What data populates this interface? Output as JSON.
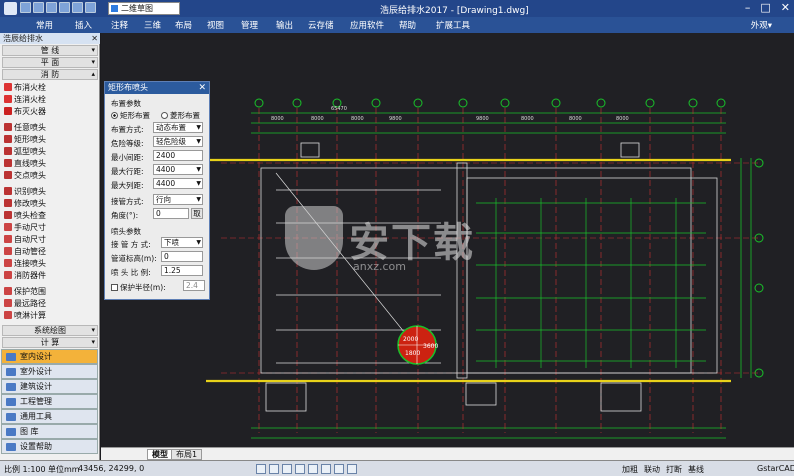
{
  "app": {
    "window_title": "浩辰给排水2017 - [Drawing1.dwg]",
    "view_combo": "二维草图",
    "outer_label": "外观▾"
  },
  "menu": [
    "常用",
    "插入",
    "注释",
    "三维",
    "布局",
    "视图",
    "管理",
    "输出",
    "云存储",
    "应用软件",
    "帮助",
    "扩展工具"
  ],
  "left_panel": {
    "title": "浩辰给排水",
    "groups": [
      "管 线",
      "平 面",
      "消 防"
    ],
    "commands": [
      {
        "label": "布消火栓",
        "icon": "hydrant-icon"
      },
      {
        "label": "连消火栓",
        "icon": "hydrant-link-icon"
      },
      {
        "label": "布灭火器",
        "icon": "extinguisher-icon"
      },
      {
        "label": "任意喷头",
        "icon": "sprinkler-icon"
      },
      {
        "label": "矩形喷头",
        "icon": "sprinkler-rect-icon"
      },
      {
        "label": "弧型喷头",
        "icon": "sprinkler-arc-icon"
      },
      {
        "label": "直线喷头",
        "icon": "sprinkler-line-icon"
      },
      {
        "label": "交点喷头",
        "icon": "sprinkler-cross-icon"
      },
      {
        "label": "识别喷头",
        "icon": "sprinkler-detect-icon"
      },
      {
        "label": "修改喷头",
        "icon": "sprinkler-edit-icon"
      },
      {
        "label": "喷头检查",
        "icon": "sprinkler-check-icon"
      },
      {
        "label": "手动尺寸",
        "icon": "dim-manual-icon"
      },
      {
        "label": "自动尺寸",
        "icon": "dim-auto-icon"
      },
      {
        "label": "自动管径",
        "icon": "pipe-diameter-icon"
      },
      {
        "label": "连接喷头",
        "icon": "sprinkler-connect-icon"
      },
      {
        "label": "消防器件",
        "icon": "fire-device-icon"
      },
      {
        "label": "保护范围",
        "icon": "protect-range-icon"
      },
      {
        "label": "最远路径",
        "icon": "far-path-icon"
      },
      {
        "label": "喷淋计算",
        "icon": "spray-calc-icon"
      }
    ],
    "sub_groups": [
      "系统绘图",
      "计 算"
    ],
    "categories": [
      {
        "label": "室内设计",
        "active": true
      },
      {
        "label": "室外设计",
        "active": false
      },
      {
        "label": "建筑设计",
        "active": false
      },
      {
        "label": "工程管理",
        "active": false
      },
      {
        "label": "通用工具",
        "active": false
      },
      {
        "label": "图 库",
        "active": false
      },
      {
        "label": "设置帮助",
        "active": false
      }
    ]
  },
  "dialog": {
    "title": "矩形布喷头",
    "section1": "布置参数",
    "radio_rect": "矩形布置",
    "radio_diamond": "菱形布置",
    "mode_label": "布置方式:",
    "mode_value": "动态布置",
    "hazard_label": "危险等级:",
    "hazard_value": "轻危险级",
    "min_spacing_label": "最小间距:",
    "min_spacing_value": "2400",
    "max_row_label": "最大行距:",
    "max_row_value": "4400",
    "max_col_label": "最大列距:",
    "max_col_value": "4400",
    "connect_label": "接管方式:",
    "connect_value": "行向",
    "angle_label": "角度(°):",
    "angle_value": "0",
    "angle_btn": "取",
    "section2": "喷头参数",
    "pipe_mode_label": "接 管 方 式:",
    "pipe_mode_value": "下喷",
    "pipe_elev_label": "管道标高(m):",
    "pipe_elev_value": "0",
    "ratio_label": "喷 头 比 例:",
    "ratio_value": "1.25",
    "protect_label": "保护半径(m):",
    "protect_value": "2.4"
  },
  "drawing": {
    "dims": [
      "8000",
      "8000",
      "8000",
      "9800",
      "9800",
      "8000",
      "8000",
      "8000"
    ],
    "total_dim": "65470",
    "circle_labels": [
      "2000",
      "1800",
      "3600"
    ]
  },
  "tabs": [
    "模型",
    "布局1"
  ],
  "status": {
    "scale": "比例 1:100",
    "unit": "单位mm",
    "coords": "43456, 24299, 0",
    "right_items": [
      "加粗",
      "联动",
      "打断",
      "基线"
    ],
    "right_app": "GstarCAD"
  },
  "watermark": {
    "text": "安下载",
    "url": "anxz.com"
  },
  "colors": {
    "title_bg": "#23468a",
    "menu_bg": "#2a5296",
    "canvas_bg": "#202024",
    "grid_line": "#19c22a",
    "wall_yellow": "#e8d21a",
    "active_cat": "#f3b23a"
  }
}
